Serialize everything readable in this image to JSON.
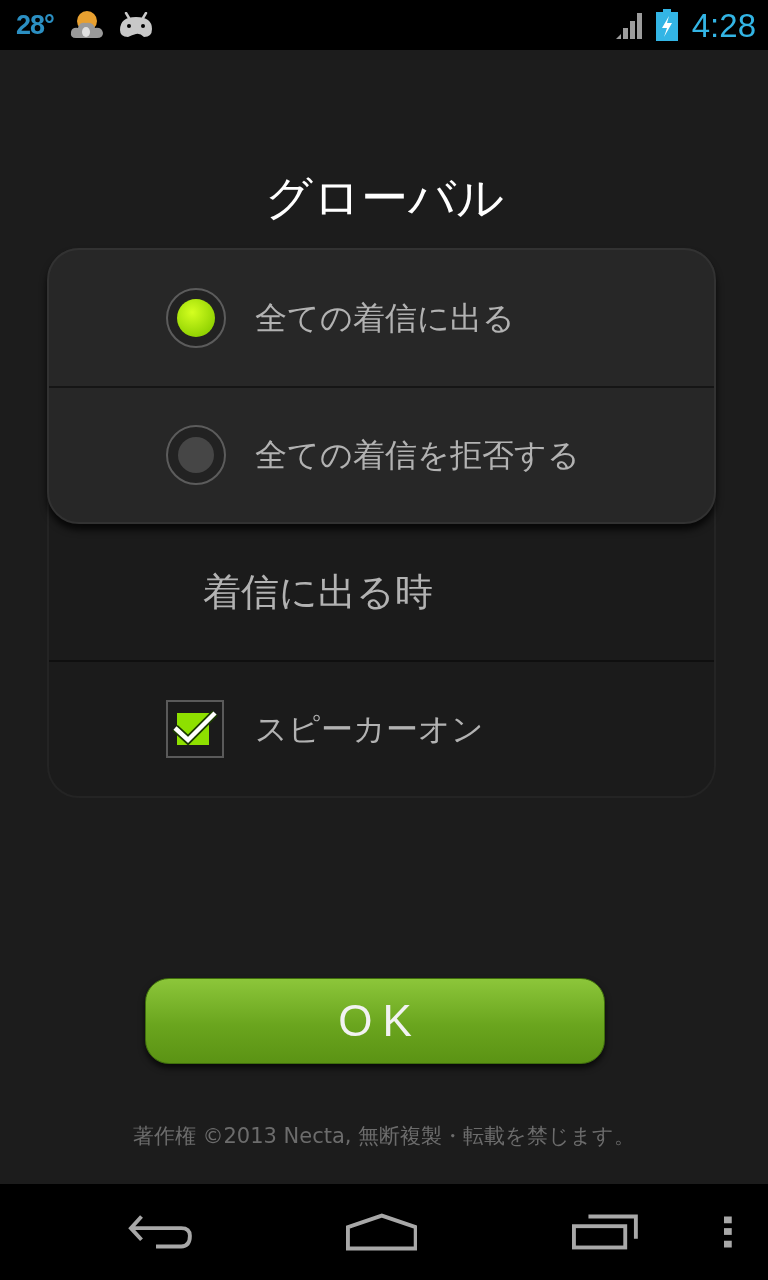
{
  "status_bar": {
    "temperature": "28°",
    "time": "4:28"
  },
  "title": "グローバル",
  "call_options": [
    {
      "label": "全ての着信に出る",
      "selected": true
    },
    {
      "label": "全ての着信を拒否する",
      "selected": false
    }
  ],
  "answer_section": {
    "heading": "着信に出る時",
    "options": [
      {
        "label": "スピーカーオン",
        "checked": true
      }
    ]
  },
  "ok_button": {
    "label": "OK"
  },
  "copyright": "著作権 ©2013 Necta, 無断複製・転載を禁じます。"
}
